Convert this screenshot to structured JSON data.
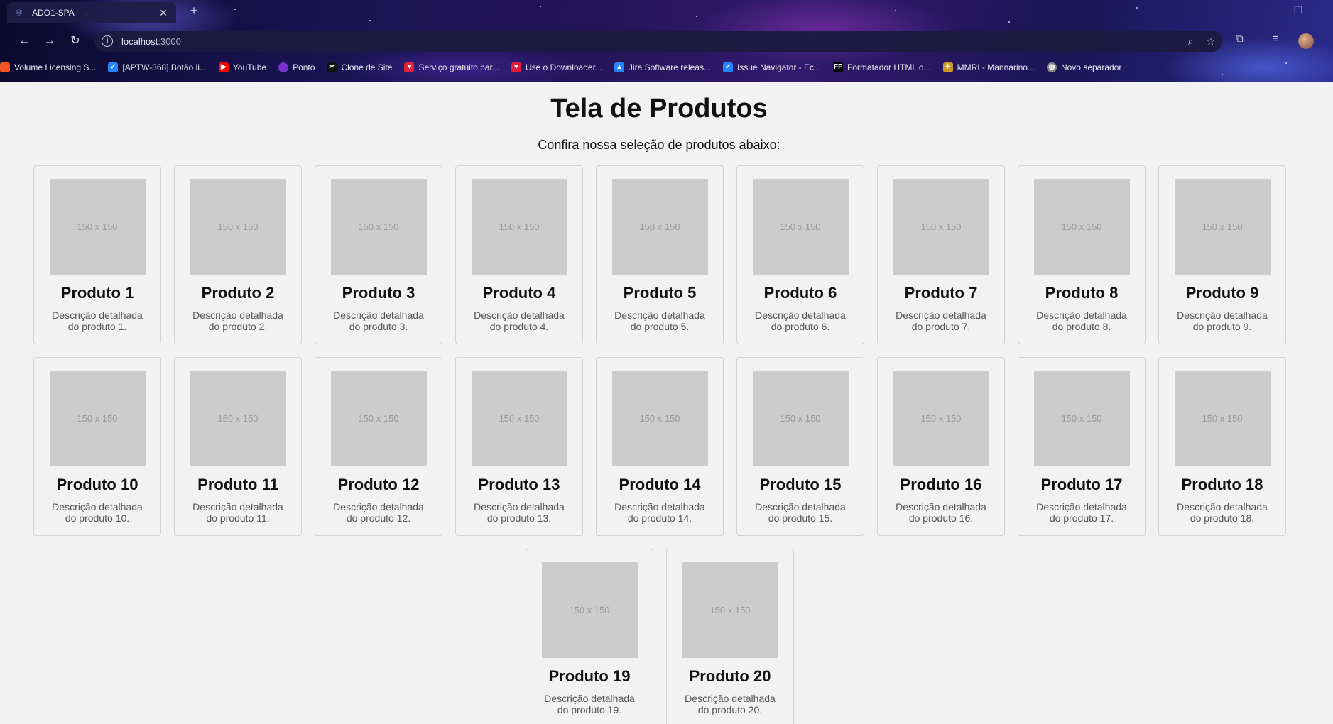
{
  "browser": {
    "tab_title": "ADO1-SPA",
    "url_host": "localhost",
    "url_port": ":3000",
    "bookmarks": [
      {
        "label": "Volume Licensing S...",
        "icon": "windows-icon",
        "color": "#f35325"
      },
      {
        "label": "[APTW-368] Botão li...",
        "icon": "jira-icon",
        "color": "#2684ff"
      },
      {
        "label": "YouTube",
        "icon": "youtube-icon",
        "color": "#ff0000"
      },
      {
        "label": "Ponto",
        "icon": "ponto-icon",
        "color": "#7a2fd0"
      },
      {
        "label": "Clone de Site",
        "icon": "clone-icon",
        "color": "#111111"
      },
      {
        "label": "Serviço gratuito par...",
        "icon": "heart-icon",
        "color": "#e2203c"
      },
      {
        "label": "Use o Downloader...",
        "icon": "heart-icon",
        "color": "#e2203c"
      },
      {
        "label": "Jira Software releas...",
        "icon": "jira-icon",
        "color": "#2684ff"
      },
      {
        "label": "Issue Navigator - Ec...",
        "icon": "jira-icon",
        "color": "#2684ff"
      },
      {
        "label": "Formatador HTML o...",
        "icon": "ff-icon",
        "color": "#000000"
      },
      {
        "label": "MMRI - Mannarino...",
        "icon": "mmri-icon",
        "color": "#c89a2a"
      },
      {
        "label": "Novo separador",
        "icon": "globe-icon",
        "color": "#888888"
      }
    ]
  },
  "page": {
    "title": "Tela de Produtos",
    "subtitle": "Confira nossa seleção de produtos abaixo:"
  },
  "products": [
    {
      "name": "Produto 1",
      "description": "Descrição detalhada do produto 1.",
      "image_text": "150 x 150"
    },
    {
      "name": "Produto 2",
      "description": "Descrição detalhada do produto 2.",
      "image_text": "150 x 150"
    },
    {
      "name": "Produto 3",
      "description": "Descrição detalhada do produto 3.",
      "image_text": "150 x 150"
    },
    {
      "name": "Produto 4",
      "description": "Descrição detalhada do produto 4.",
      "image_text": "150 x 150"
    },
    {
      "name": "Produto 5",
      "description": "Descrição detalhada do produto 5.",
      "image_text": "150 x 150"
    },
    {
      "name": "Produto 6",
      "description": "Descrição detalhada do produto 6.",
      "image_text": "150 x 150"
    },
    {
      "name": "Produto 7",
      "description": "Descrição detalhada do produto 7.",
      "image_text": "150 x 150"
    },
    {
      "name": "Produto 8",
      "description": "Descrição detalhada do produto 8.",
      "image_text": "150 x 150"
    },
    {
      "name": "Produto 9",
      "description": "Descrição detalhada do produto 9.",
      "image_text": "150 x 150"
    },
    {
      "name": "Produto 10",
      "description": "Descrição detalhada do produto 10.",
      "image_text": "150 x 150"
    },
    {
      "name": "Produto 11",
      "description": "Descrição detalhada do produto 11.",
      "image_text": "150 x 150"
    },
    {
      "name": "Produto 12",
      "description": "Descrição detalhada do produto 12.",
      "image_text": "150 x 150"
    },
    {
      "name": "Produto 13",
      "description": "Descrição detalhada do produto 13.",
      "image_text": "150 x 150"
    },
    {
      "name": "Produto 14",
      "description": "Descrição detalhada do produto 14.",
      "image_text": "150 x 150"
    },
    {
      "name": "Produto 15",
      "description": "Descrição detalhada do produto 15.",
      "image_text": "150 x 150"
    },
    {
      "name": "Produto 16",
      "description": "Descrição detalhada do produto 16.",
      "image_text": "150 x 150"
    },
    {
      "name": "Produto 17",
      "description": "Descrição detalhada do produto 17.",
      "image_text": "150 x 150"
    },
    {
      "name": "Produto 18",
      "description": "Descrição detalhada do produto 18.",
      "image_text": "150 x 150"
    },
    {
      "name": "Produto 19",
      "description": "Descrição detalhada do produto 19.",
      "image_text": "150 x 150"
    },
    {
      "name": "Produto 20",
      "description": "Descrição detalhada do produto 20.",
      "image_text": "150 x 150"
    }
  ],
  "colors": {
    "page_background": "#f2f2f2",
    "placeholder": "#cccccc",
    "card_border": "#d2d2d2"
  }
}
